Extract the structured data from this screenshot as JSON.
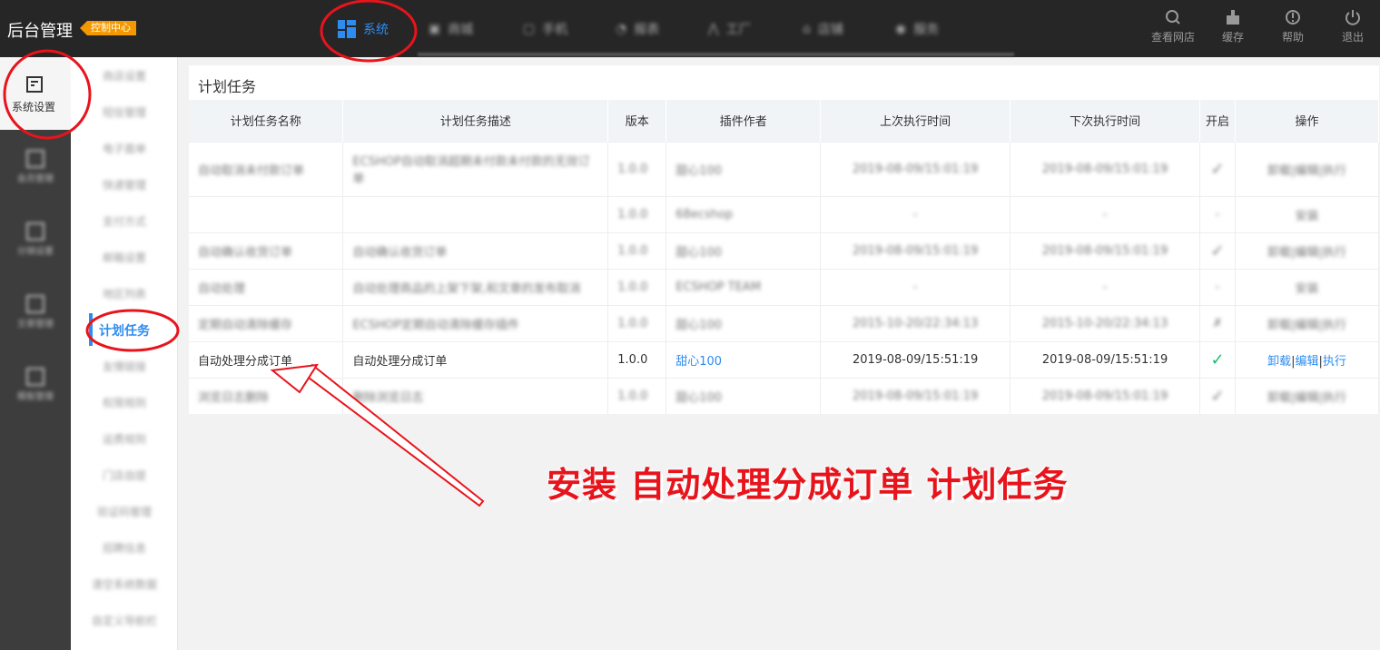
{
  "header": {
    "brand": "后台管理",
    "badge": "控制中心",
    "nav": [
      {
        "label": "系统",
        "active": true
      },
      {
        "label": "商城"
      },
      {
        "label": "手机"
      },
      {
        "label": "报表"
      },
      {
        "label": "工厂"
      },
      {
        "label": "店铺"
      },
      {
        "label": "服务"
      }
    ],
    "tools": [
      {
        "label": "查看网店",
        "icon": "search-icon"
      },
      {
        "label": "缓存",
        "icon": "broom-icon"
      },
      {
        "label": "帮助",
        "icon": "info-icon"
      },
      {
        "label": "退出",
        "icon": "power-icon"
      }
    ]
  },
  "sidebar": {
    "active_label": "系统设置",
    "items": [
      "会员管理",
      "分销设置",
      "文章管理",
      "模板管理"
    ]
  },
  "subnav": {
    "items": [
      "商店设置",
      "短信管理",
      "电子面单",
      "快递管理",
      "支付方式",
      "邮箱设置",
      "地区列表",
      "计划任务",
      "友情链接",
      "权限规则",
      "运费规则",
      "门店自提",
      "验证码管理",
      "招聘信息",
      "清空系统数据",
      "自定义导航栏"
    ],
    "active_index": 7
  },
  "page": {
    "title": "计划任务",
    "columns": [
      "计划任务名称",
      "计划任务描述",
      "版本",
      "插件作者",
      "上次执行时间",
      "下次执行时间",
      "开启",
      "操作"
    ],
    "rows": [
      {
        "name": "自动取消未付款订单",
        "desc": "ECSHOP自动取消超期未付款未付款的无效订单",
        "version": "1.0.0",
        "author": "甜心100",
        "last": "2019-08-09/15:01:19",
        "next": "2019-08-09/15:01:19",
        "status": "✓",
        "ops": "卸载|编辑|执行",
        "blur": true,
        "tall": true
      },
      {
        "name": "",
        "desc": "",
        "version": "1.0.0",
        "author": "68ecshop",
        "last": "-",
        "next": "-",
        "status": "-",
        "ops": "安装",
        "blur": true
      },
      {
        "name": "自动确认收货订单",
        "desc": "自动确认收货订单",
        "version": "1.0.0",
        "author": "甜心100",
        "last": "2019-08-09/15:01:19",
        "next": "2019-08-09/15:01:19",
        "status": "✓",
        "ops": "卸载|编辑|执行",
        "blur": true
      },
      {
        "name": "自动处理",
        "desc": "自动处理商品的上架下架,和文章的发布取消",
        "version": "1.0.0",
        "author": "ECSHOP TEAM",
        "last": "-",
        "next": "-",
        "status": "-",
        "ops": "安装",
        "blur": true
      },
      {
        "name": "定期自动清除缓存",
        "desc": "ECSHOP定期自动清除缓存插件",
        "version": "1.0.0",
        "author": "甜心100",
        "last": "2015-10-20/22:34:13",
        "next": "2015-10-20/22:34:13",
        "status": "✗",
        "ops": "卸载|编辑|执行",
        "blur": true
      },
      {
        "name": "自动处理分成订单",
        "desc": "自动处理分成订单",
        "version": "1.0.0",
        "author": "甜心100",
        "last": "2019-08-09/15:51:19",
        "next": "2019-08-09/15:51:19",
        "status": "✓",
        "ops_uninstall": "卸载",
        "ops_edit": "编辑",
        "ops_run": "执行",
        "blur": false
      },
      {
        "name": "浏览日志删除",
        "desc": "删除浏览日志",
        "version": "1.0.0",
        "author": "甜心100",
        "last": "2019-08-09/15:01:19",
        "next": "2019-08-09/15:01:19",
        "status": "✓",
        "ops": "卸载|编辑|执行",
        "blur": true
      }
    ]
  },
  "annotation": "安装  自动处理分成订单  计划任务",
  "colors": {
    "accent": "#2d8cf0",
    "annotation": "#e8141c",
    "topbar": "#262626"
  }
}
